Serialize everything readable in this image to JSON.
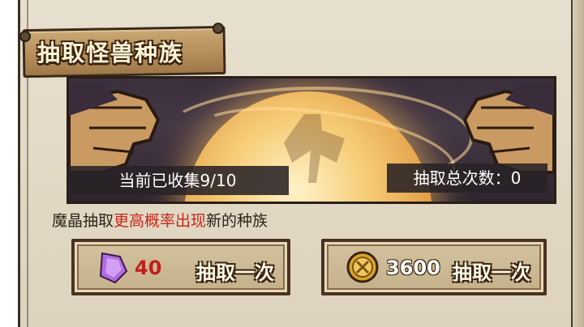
{
  "title": "抽取怪兽种族",
  "collection": {
    "label": "当前已收集9/10"
  },
  "total_draws": {
    "label": "抽取总次数：0"
  },
  "hint": {
    "prefix": "魔晶抽取",
    "highlight": "更高概率出现",
    "suffix": "新的种族"
  },
  "buttons": {
    "crystal": {
      "cost": "40",
      "label": "抽取一次",
      "icon": "crystal-icon"
    },
    "gold": {
      "cost": "3600",
      "label": "抽取一次",
      "icon": "gold-coin-icon"
    }
  },
  "colors": {
    "highlight": "#c6281c",
    "crystal_cost": "#c01e1e"
  }
}
